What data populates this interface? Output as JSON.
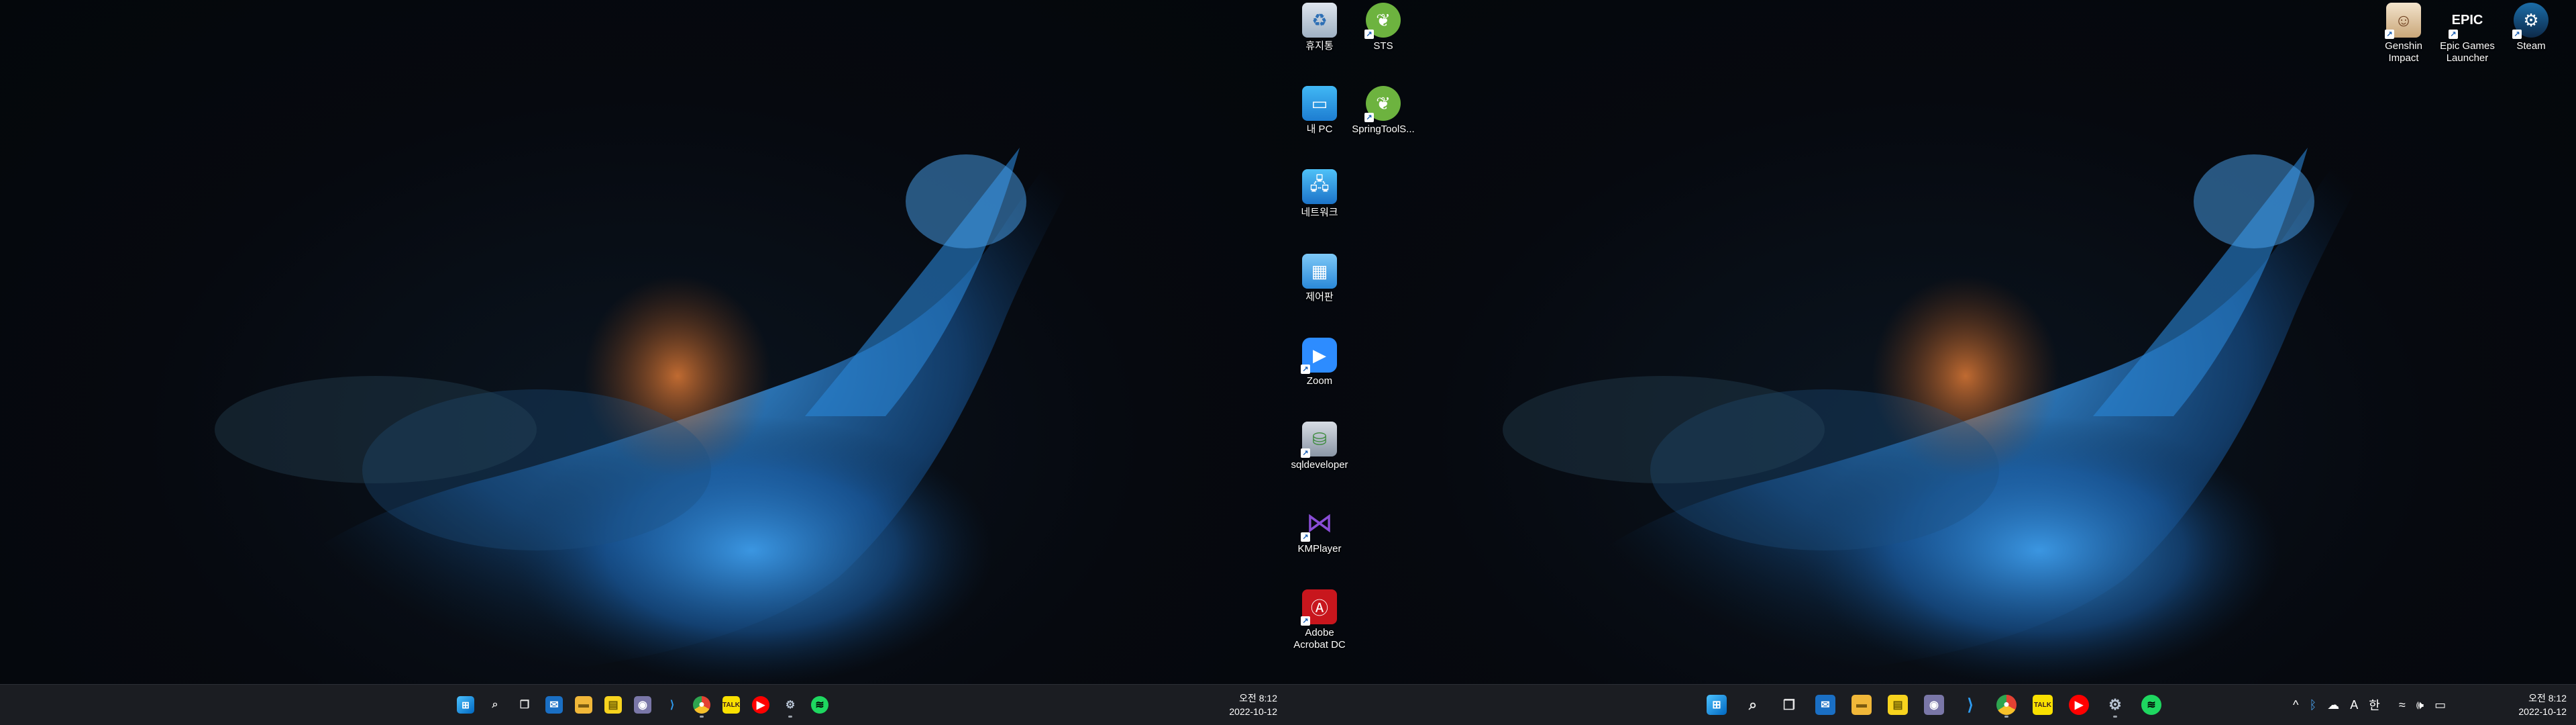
{
  "desktop_icons_left": [
    {
      "label": "휴지통",
      "icon": "recycle-bin-icon",
      "shortcut": false
    },
    {
      "label": "STS",
      "icon": "spring-tools-icon",
      "shortcut": true
    },
    {
      "label": "내 PC",
      "icon": "computer-icon",
      "shortcut": false
    },
    {
      "label": "SpringToolS...",
      "icon": "spring-tools-icon",
      "shortcut": true
    },
    {
      "label": "네트워크",
      "icon": "network-icon",
      "shortcut": false
    },
    {
      "label": "제어판",
      "icon": "control-panel-icon",
      "shortcut": false
    },
    {
      "label": "Zoom",
      "icon": "zoom-icon",
      "shortcut": true
    },
    {
      "label": "sqldeveloper",
      "icon": "sqldeveloper-icon",
      "shortcut": true
    },
    {
      "label": "KMPlayer",
      "icon": "kmplayer-icon",
      "shortcut": true
    },
    {
      "label": "Adobe Acrobat DC",
      "icon": "acrobat-icon",
      "shortcut": true
    }
  ],
  "desktop_icons_right": [
    {
      "label": "Genshin Impact",
      "icon": "genshin-icon",
      "shortcut": true
    },
    {
      "label": "Epic Games Launcher",
      "icon": "epic-games-icon",
      "shortcut": true
    },
    {
      "label": "Steam",
      "icon": "steam-icon",
      "shortcut": true
    }
  ],
  "taskbar_left": {
    "apps": [
      "start-icon",
      "search-icon",
      "task-view-icon",
      "mail-icon",
      "file-explorer-icon",
      "sticky-notes-icon",
      "discord-icon",
      "vscode-icon",
      "chrome-icon",
      "kakaotalk-icon",
      "youtube-music-icon",
      "settings-icon",
      "spotify-icon"
    ],
    "clock_time": "오전 8:12",
    "clock_date": "2022-10-12"
  },
  "taskbar_right": {
    "apps": [
      "start-icon",
      "search-icon",
      "task-view-icon",
      "mail-icon",
      "file-explorer-icon",
      "sticky-notes-icon",
      "discord-icon",
      "vscode-icon",
      "chrome-icon",
      "kakaotalk-icon",
      "youtube-music-icon",
      "settings-icon",
      "spotify-icon"
    ],
    "tray_chevron": "^",
    "tray_ime_a": "A",
    "tray_ime_han": "한",
    "clock_time": "오전 8:12",
    "clock_date": "2022-10-12"
  },
  "colors": {
    "taskbar": "#1b1d22",
    "wallpaper_blue": "#1f7fd4",
    "wallpaper_orange": "#d2692a"
  }
}
